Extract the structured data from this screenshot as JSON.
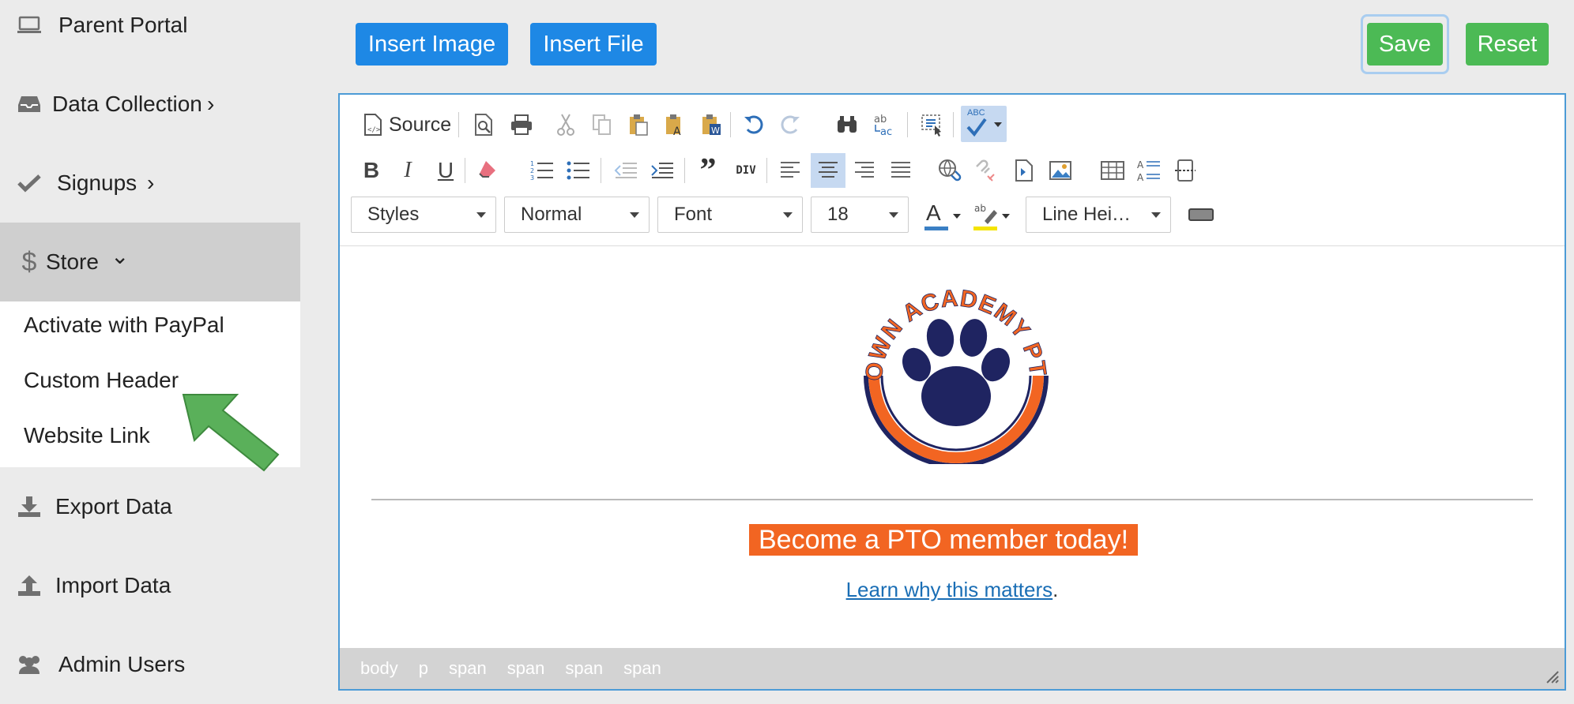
{
  "sidebar": {
    "items": [
      {
        "label": "Parent Portal",
        "icon": "laptop-icon"
      },
      {
        "label": "Data Collection",
        "icon": "inbox-icon",
        "chevron": "›"
      },
      {
        "label": "Signups",
        "icon": "check-icon",
        "chevron": "›"
      },
      {
        "label": "Store",
        "icon": "dollar-icon",
        "chevron": "⌄"
      },
      {
        "label": "Export Data",
        "icon": "download-icon"
      },
      {
        "label": "Import Data",
        "icon": "upload-icon"
      },
      {
        "label": "Admin Users",
        "icon": "users-icon"
      }
    ],
    "store_submenu": [
      "Activate with PayPal",
      "Custom Header",
      "Website Link"
    ]
  },
  "topbar": {
    "insert_image": "Insert Image",
    "insert_file": "Insert File",
    "save": "Save",
    "reset": "Reset"
  },
  "toolbar": {
    "source_label": "Source",
    "styles": "Styles",
    "format": "Normal",
    "font": "Font",
    "size": "18",
    "line_height": "Line Hei…",
    "div_label": "DIV",
    "spell_label": "ABC"
  },
  "content": {
    "logo_text": "TOWN ACADEMY PTO",
    "banner": "Become a PTO member today!",
    "link_text": "Learn why this matters",
    "link_suffix": "."
  },
  "statusbar": {
    "path": [
      "body",
      "p",
      "span",
      "span",
      "span",
      "span"
    ]
  },
  "colors": {
    "accent_blue": "#1e88e5",
    "save_green": "#4cba55",
    "banner_orange": "#f26522",
    "navy": "#1f2461",
    "link": "#1a6eb5"
  }
}
